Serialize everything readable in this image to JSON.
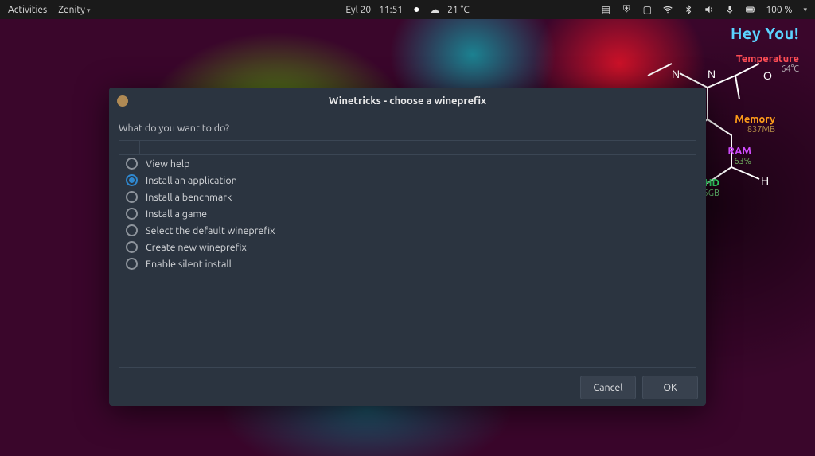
{
  "topbar": {
    "activities": "Activities",
    "app_menu": "Zenity",
    "date": "Eyl 20",
    "time": "11:51",
    "weather": "21 °C",
    "battery": "100 %"
  },
  "monitor": {
    "greeting": "Hey You!",
    "temperature_label": "Temperature",
    "temperature_value": "64°C",
    "memory_label": "Memory",
    "memory_value": "837MB",
    "ram_label": "RAM",
    "ram_value": "63%",
    "hd_label": "HD",
    "hd_value": "5GB",
    "atoms": {
      "n": "N",
      "o": "O",
      "h": "H"
    }
  },
  "dialog": {
    "title": "Winetricks - choose a wineprefix",
    "prompt": "What do you want to do?",
    "options": [
      "View help",
      "Install an application",
      "Install a benchmark",
      "Install a game",
      "Select the default wineprefix",
      "Create new wineprefix",
      "Enable silent install"
    ],
    "selected_index": 1,
    "cancel": "Cancel",
    "ok": "OK"
  }
}
